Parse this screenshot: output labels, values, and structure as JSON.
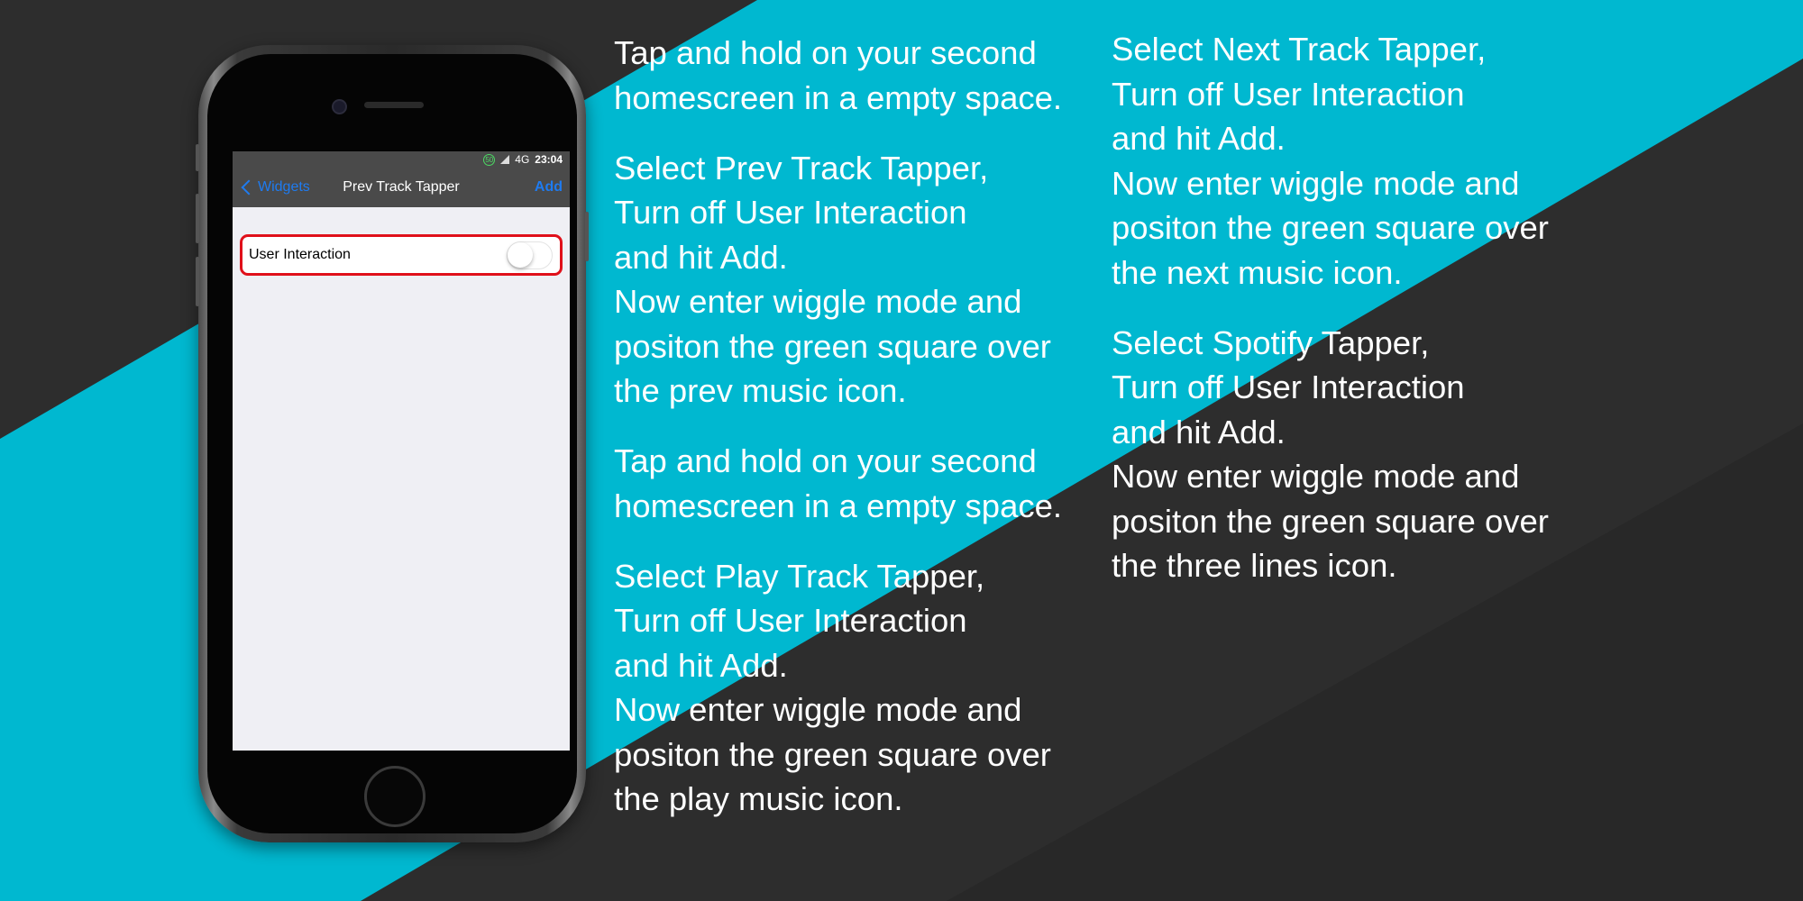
{
  "colors": {
    "background_dark": "#2d2d2d",
    "accent_band": "#00b8d0",
    "ios_blue": "#1e7bf0",
    "highlight_red": "#e0101a"
  },
  "phone": {
    "status_bar": {
      "battery_percent": "50",
      "network": "4G",
      "time": "23:04"
    },
    "nav": {
      "back_label": "Widgets",
      "title": "Prev Track Tapper",
      "add_label": "Add"
    },
    "setting": {
      "label": "User Interaction",
      "toggle_on": false
    }
  },
  "instructions": {
    "column1": [
      [
        "Tap and hold on your second",
        "homescreen in a empty space."
      ],
      [
        "Select Prev Track Tapper,",
        "Turn off User Interaction",
        "and hit Add.",
        "Now enter wiggle mode and",
        "positon the green square over",
        "the prev music icon."
      ],
      [
        "Tap and hold on your second",
        "homescreen in a empty space."
      ],
      [
        "Select Play Track Tapper,",
        "Turn off User Interaction",
        "and hit Add.",
        "Now enter wiggle mode and",
        "positon the green square over",
        "the play music icon."
      ]
    ],
    "column2": [
      [
        "Select Next Track Tapper,",
        "Turn off User Interaction",
        "and hit Add.",
        "Now enter wiggle mode and",
        "positon the green square over",
        "the next music icon."
      ],
      [
        "Select Spotify Tapper,",
        "Turn off User Interaction",
        "and hit Add.",
        "Now enter wiggle mode and",
        "positon the green square over",
        "the three lines icon."
      ]
    ]
  }
}
